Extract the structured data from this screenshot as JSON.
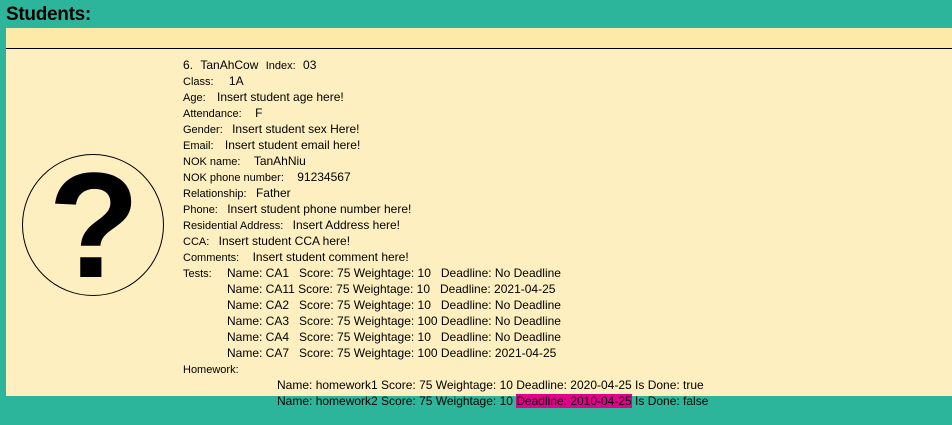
{
  "header": {
    "title": "Students:"
  },
  "student": {
    "number": "6.",
    "name": "TanAhCow",
    "index_label": "Index:",
    "index": "03",
    "class_label": "Class:",
    "class": "1A",
    "age_label": "Age:",
    "age": "Insert student age here!",
    "attendance_label": "Attendance:",
    "attendance": "F",
    "gender_label": "Gender:",
    "gender": "Insert student sex Here!",
    "email_label": "Email:",
    "email": "Insert student email here!",
    "nok_name_label": "NOK name:",
    "nok_name": "TanAhNiu",
    "nok_phone_label": "NOK phone number:",
    "nok_phone": "91234567",
    "relationship_label": "Relationship:",
    "relationship": "Father",
    "phone_label": "Phone:",
    "phone": "Insert student phone number here!",
    "address_label": "Residential Address:",
    "address": "Insert Address here!",
    "cca_label": "CCA:",
    "cca": "Insert student CCA here!",
    "comments_label": "Comments:",
    "comments": "Insert student comment here!",
    "tests_label": "Tests:",
    "tests": [
      "Name: CA1   Score: 75 Weightage: 10   Deadline: No Deadline",
      "Name: CA11 Score: 75 Weightage: 10   Deadline: 2021-04-25",
      "Name: CA2   Score: 75 Weightage: 10   Deadline: No Deadline",
      "Name: CA3   Score: 75 Weightage: 100 Deadline: No Deadline",
      "Name: CA4   Score: 75 Weightage: 10   Deadline: No Deadline",
      "Name: CA7   Score: 75 Weightage: 100 Deadline: 2021-04-25"
    ],
    "homework_label": "Homework:",
    "homework": [
      {
        "pre": "Name: homework1 Score: 75 Weightage: 10 ",
        "deadline": "Deadline: 2020-04-25",
        "post": " Is Done: true",
        "overdue": false
      },
      {
        "pre": "Name: homework2 Score: 75 Weightage: 10 ",
        "deadline": "Deadline: 2010-04-25",
        "post": " Is Done: false",
        "overdue": true
      }
    ]
  },
  "colors": {
    "background": "#2db59b",
    "card": "#fdefbf",
    "strip": "#fde9a8",
    "overdue_highlight": "#e0008b"
  },
  "avatar": {
    "icon": "question-mark-icon"
  }
}
